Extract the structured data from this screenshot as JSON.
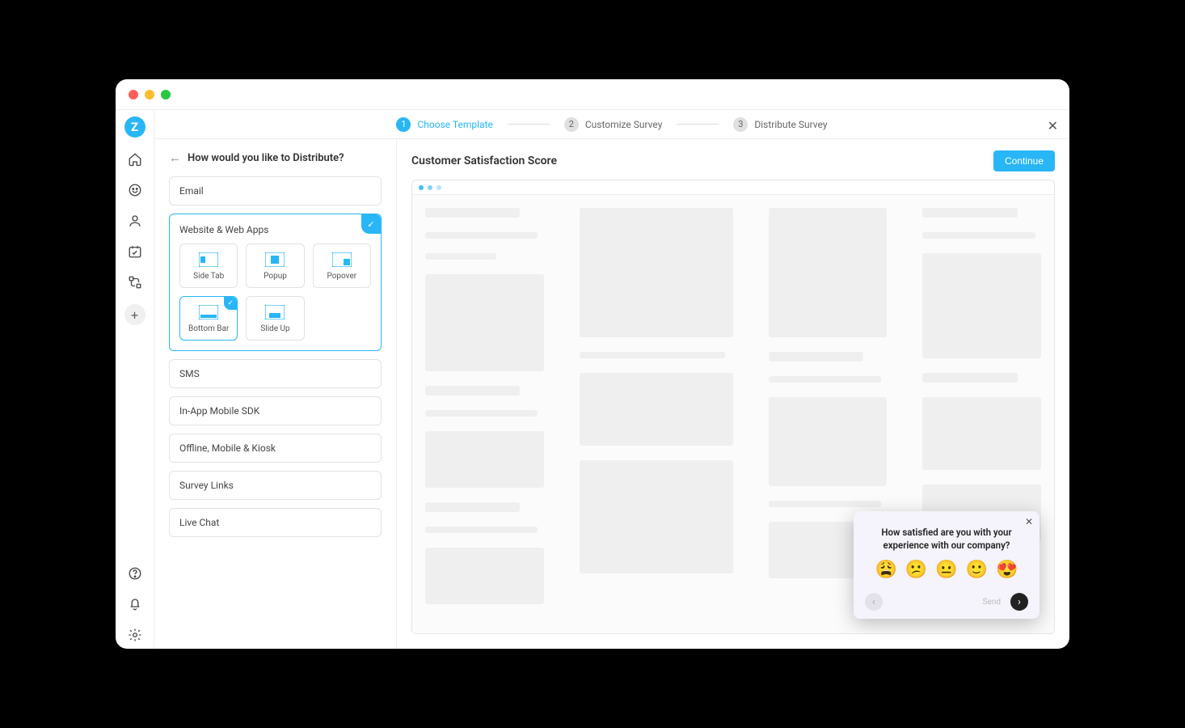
{
  "stepper": {
    "steps": [
      {
        "num": "1",
        "label": "Choose Template",
        "active": true
      },
      {
        "num": "2",
        "label": "Customize Survey",
        "active": false
      },
      {
        "num": "3",
        "label": "Distribute Survey",
        "active": false
      }
    ]
  },
  "leftPanel": {
    "title": "How would you like to Distribute?",
    "channels": {
      "email": "Email",
      "web": "Website & Web Apps",
      "sms": "SMS",
      "sdk": "In-App Mobile SDK",
      "offline": "Offline, Mobile & Kiosk",
      "links": "Survey Links",
      "chat": "Live Chat"
    },
    "webOptions": {
      "sideTab": "Side Tab",
      "popup": "Popup",
      "popover": "Popover",
      "bottomBar": "Bottom Bar",
      "slideUp": "Slide Up"
    }
  },
  "rightPanel": {
    "title": "Customer Satisfaction Score",
    "continue": "Continue"
  },
  "widget": {
    "question": "How satisfied are you with your experience with our company?",
    "emojis": [
      "😩",
      "😕",
      "😐",
      "🙂",
      "😍"
    ],
    "send": "Send"
  }
}
